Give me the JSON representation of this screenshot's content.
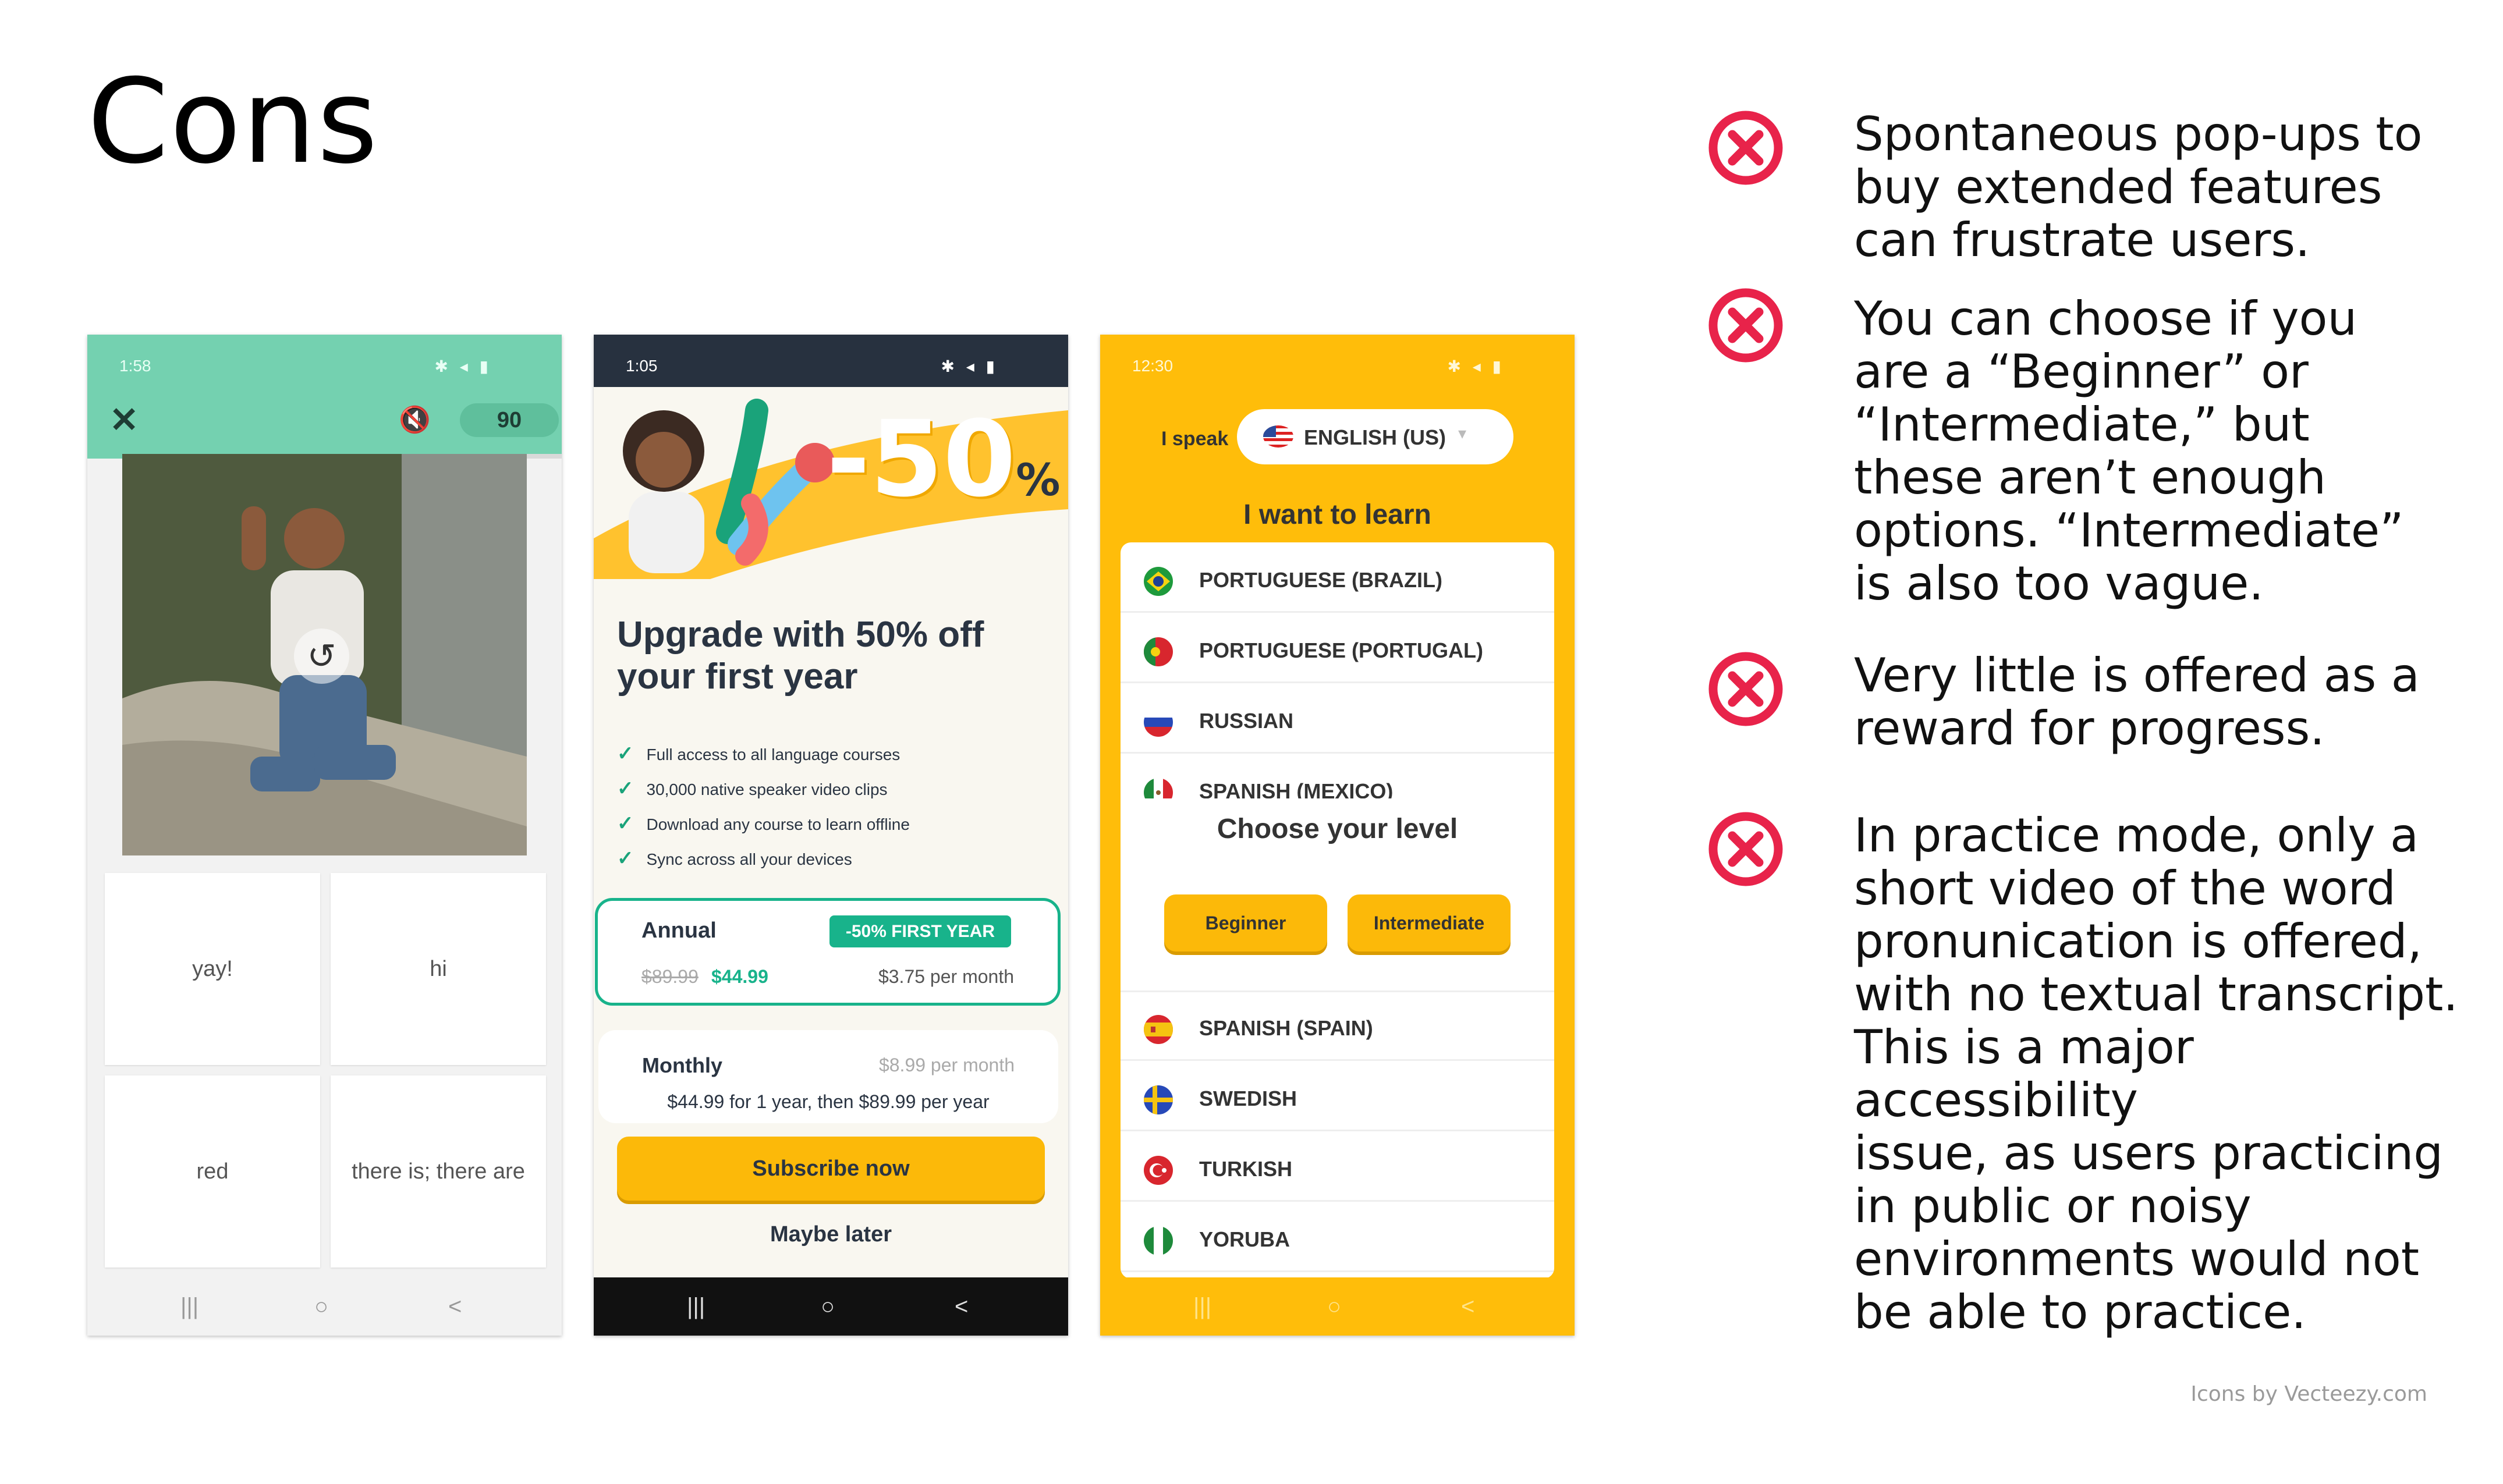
{
  "slide": {
    "title": "Cons",
    "credit": "Icons by Vecteezy.com"
  },
  "cons": [
    {
      "icon": "x-circle-icon",
      "text": "Spontaneous pop-ups to\nbuy extended features\ncan frustrate users."
    },
    {
      "icon": "x-circle-icon",
      "text": "You can choose if you\nare a “Beginner” or\n“Intermediate,” but\nthese aren’t enough\noptions. “Intermediate”\nis also too vague."
    },
    {
      "icon": "x-circle-icon",
      "text": "Very little is offered as a\nreward for progress."
    },
    {
      "icon": "x-circle-icon",
      "text": "In practice mode, only a\nshort video of the word\npronunication is offered,\nwith no textual transcript.\nThis is a major accessibility\nissue, as users practicing\nin public or noisy\nenvironments would not\nbe able to practice."
    }
  ],
  "colors": {
    "accent_red": "#e8234a",
    "teal": "#74d1b0",
    "yellow": "#ffbd0a",
    "green": "#18b38b"
  },
  "phone1": {
    "time": "1:58",
    "score": "90",
    "progress": 0.32,
    "choices": [
      "yay!",
      "hi",
      "red",
      "there is; there are"
    ]
  },
  "phone2": {
    "time": "1:05",
    "promo": "-50",
    "promo_suffix": "%",
    "headline": "Upgrade with 50% off your first year",
    "features": [
      "Full access to all language courses",
      "30,000 native speaker video clips",
      "Download any course to learn offline",
      "Sync across all your devices"
    ],
    "annual": {
      "label": "Annual",
      "badge": "-50% FIRST YEAR",
      "old_price": "$89.99",
      "price": "$44.99",
      "per_month": "$3.75 per month"
    },
    "monthly": {
      "label": "Monthly",
      "per_month": "$8.99 per month",
      "terms": "$44.99 for 1 year, then $89.99 per year"
    },
    "subscribe": "Subscribe now",
    "maybe_later": "Maybe later"
  },
  "phone3": {
    "time": "12:30",
    "i_speak": "I speak",
    "speak_language": "ENGLISH (US)",
    "want_to_learn": "I want to learn",
    "languages_top": [
      "PORTUGUESE (BRAZIL)",
      "PORTUGUESE (PORTUGAL)",
      "RUSSIAN",
      "SPANISH (MEXICO)"
    ],
    "choose_level": "Choose your level",
    "beginner": "Beginner",
    "intermediate": "Intermediate",
    "languages_bottom": [
      "SPANISH (SPAIN)",
      "SWEDISH",
      "TURKISH",
      "YORUBA"
    ]
  },
  "navbar": {
    "recent": "|||",
    "home": "○",
    "back": "<"
  }
}
